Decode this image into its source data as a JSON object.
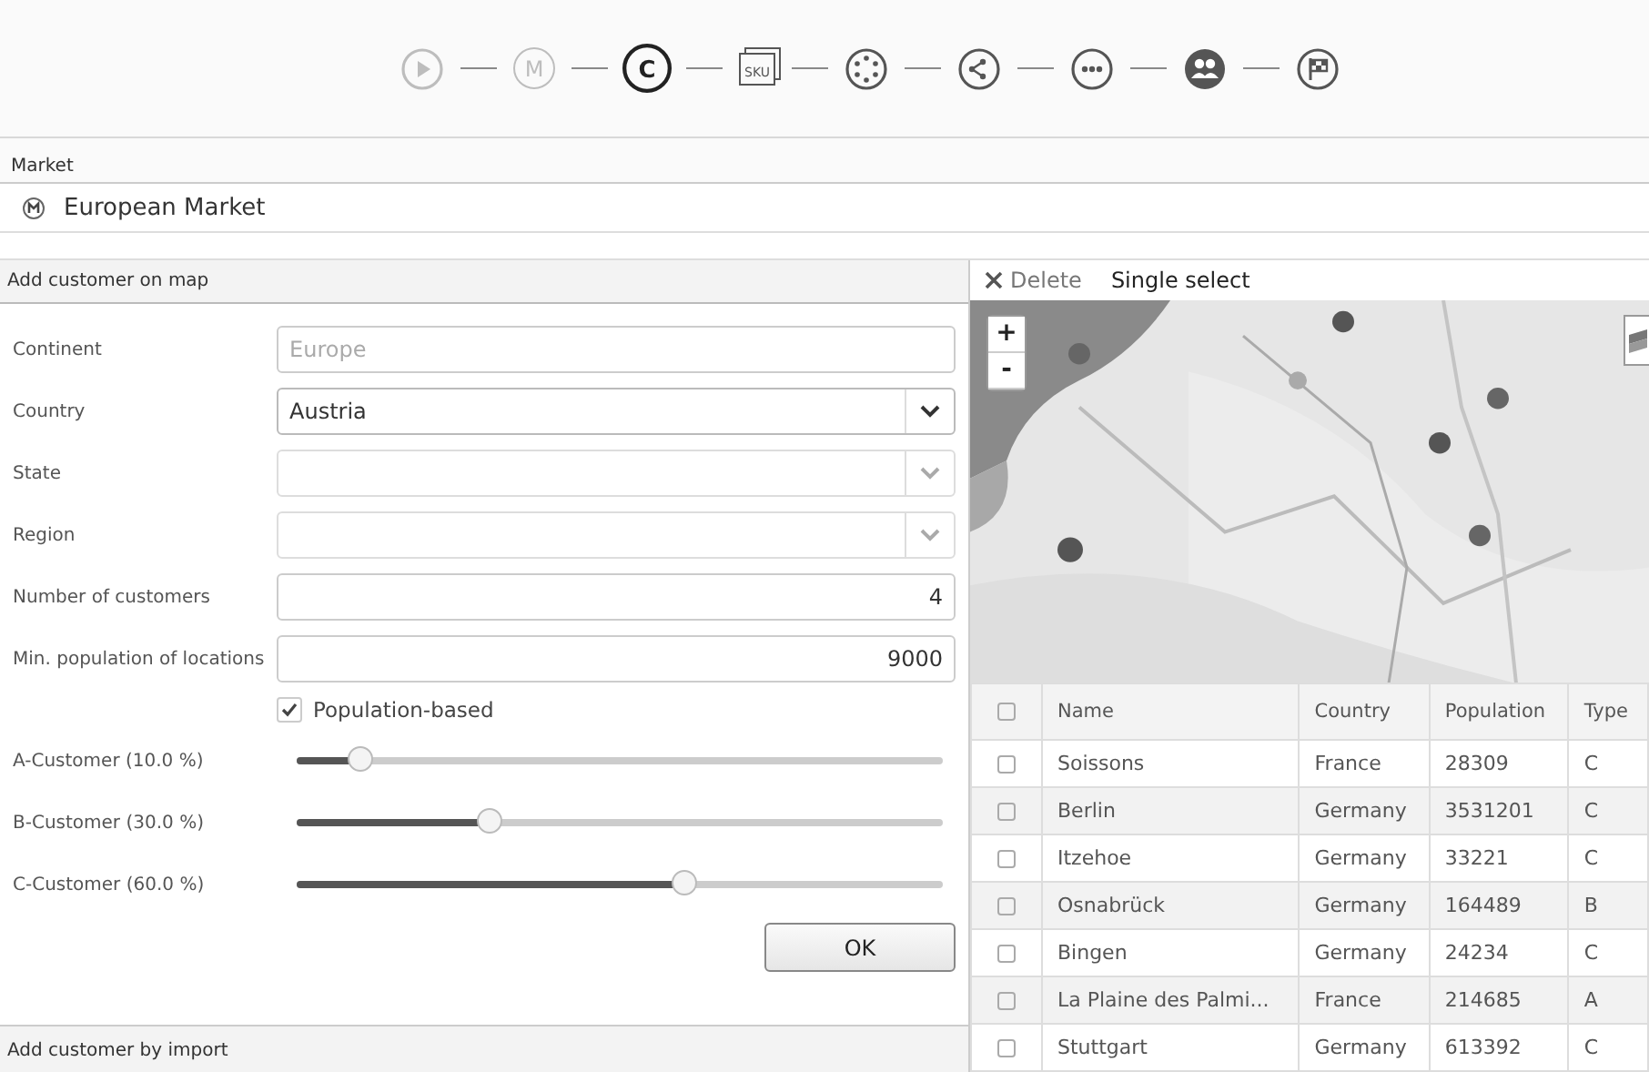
{
  "steps": [
    {
      "kind": "play",
      "completed": true,
      "selected": false
    },
    {
      "kind": "letter",
      "label": "M",
      "completed": true,
      "selected": false
    },
    {
      "kind": "letter",
      "label": "C",
      "completed": false,
      "selected": true
    },
    {
      "kind": "box",
      "label": "SKU",
      "completed": false,
      "selected": false
    },
    {
      "kind": "dots-circle",
      "completed": false,
      "selected": false
    },
    {
      "kind": "nodes",
      "completed": false,
      "selected": false
    },
    {
      "kind": "ellipsis",
      "completed": false,
      "selected": false
    },
    {
      "kind": "people",
      "completed": false,
      "selected": false
    },
    {
      "kind": "flag",
      "completed": false,
      "selected": false
    }
  ],
  "market": {
    "label": "Market",
    "value": "European Market"
  },
  "left_panel": {
    "title": "Add customer on map",
    "fields": [
      {
        "kind": "input",
        "label": "Continent",
        "placeholder": "Europe",
        "numeric": false
      },
      {
        "kind": "select",
        "label": "Country",
        "value": "Austria",
        "disabled": false
      },
      {
        "kind": "select",
        "label": "State",
        "disabled": true
      },
      {
        "kind": "select",
        "label": "Region",
        "disabled": true
      },
      {
        "kind": "input",
        "label": "Number of customers",
        "value": "4",
        "numeric": true
      },
      {
        "kind": "input",
        "label": "Min. population of locations",
        "value": "9000",
        "numeric": true
      }
    ],
    "checkbox": {
      "label": "Population-based",
      "checked": true
    },
    "sliders": [
      {
        "label": "A-Customer (10.0 %)",
        "level": 0.1
      },
      {
        "label": "B-Customer (30.0 %)",
        "level": 0.3
      },
      {
        "label": "C-Customer (60.0 %)",
        "level": 0.6
      }
    ],
    "ok_button": "OK",
    "footer_title": "Add customer by import"
  },
  "map_toolbar": {
    "delete": "Delete",
    "single_select": "Single select"
  },
  "map": {
    "kind": "picture",
    "zoom_in": "+",
    "zoom_out": "-"
  },
  "table": {
    "columns": [
      "Name",
      "Country",
      "Population",
      "Type"
    ],
    "header_checked": false,
    "rows": [
      {
        "cells": [
          "Soissons",
          "France",
          "28309",
          "C"
        ],
        "checked": false
      },
      {
        "cells": [
          "Berlin",
          "Germany",
          "3531201",
          "C"
        ],
        "checked": false
      },
      {
        "cells": [
          "Itzehoe",
          "Germany",
          "33221",
          "C"
        ],
        "checked": false
      },
      {
        "cells": [
          "Osnabrück",
          "Germany",
          "164489",
          "B"
        ],
        "checked": false
      },
      {
        "cells": [
          "Bingen",
          "Germany",
          "24234",
          "C"
        ],
        "checked": false
      },
      {
        "cells": [
          "La Plaine des Palmi...",
          "France",
          "214685",
          "A"
        ],
        "checked": false
      },
      {
        "cells": [
          "Stuttgart",
          "Germany",
          "613392",
          "C"
        ],
        "checked": false
      }
    ]
  }
}
